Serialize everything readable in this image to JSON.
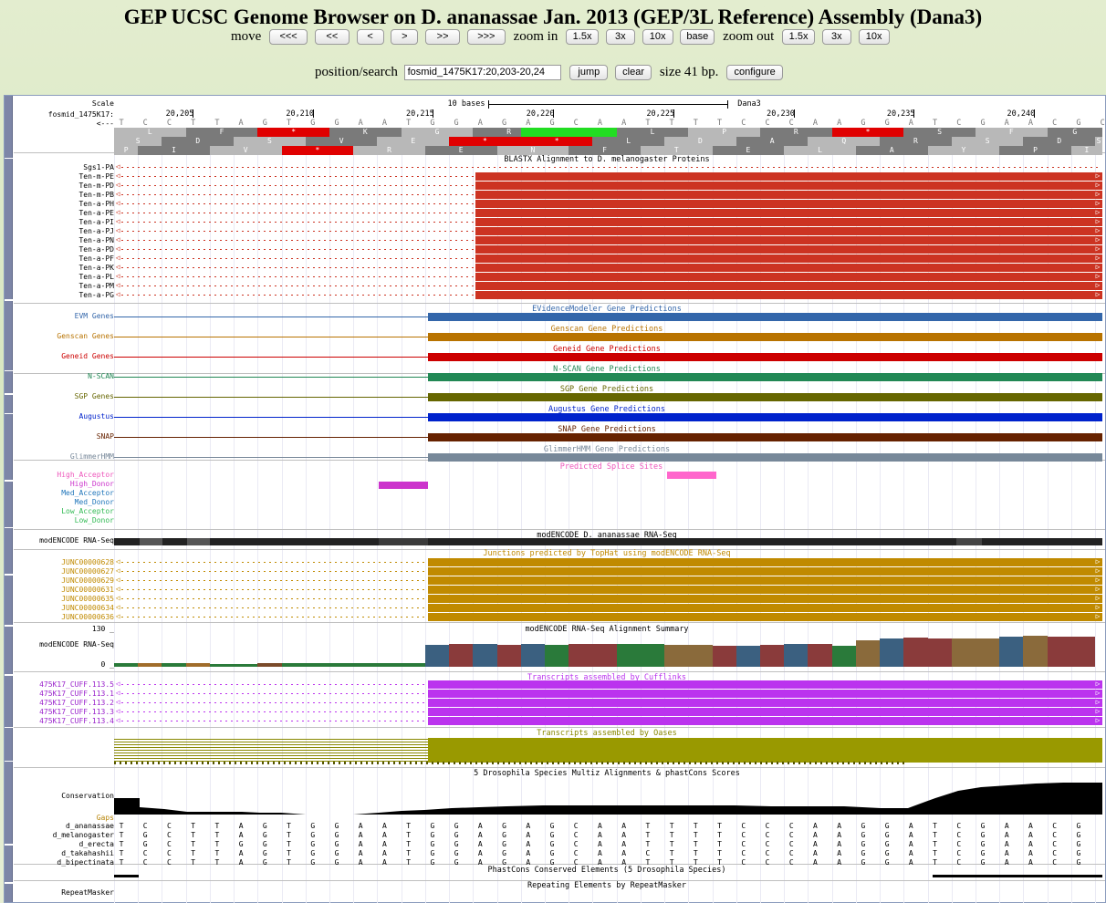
{
  "title": "GEP UCSC Genome Browser on D. ananassae Jan. 2013 (GEP/3L Reference) Assembly (Dana3)",
  "controls": {
    "move_label": "move",
    "move_buttons": [
      "<<<",
      "<<",
      "<",
      ">",
      ">>",
      ">>>"
    ],
    "zoom_in_label": "zoom in",
    "zoom_in_buttons": [
      "1.5x",
      "3x",
      "10x"
    ],
    "base_button": "base",
    "zoom_out_label": "zoom out",
    "zoom_out_buttons": [
      "1.5x",
      "3x",
      "10x"
    ],
    "position_label": "position/search",
    "position_value": "fosmid_1475K17:20,203-20,24",
    "jump": "jump",
    "clear": "clear",
    "size_text": "size 41 bp.",
    "configure": "configure"
  },
  "ruler": {
    "scale_label": "Scale",
    "chrom_label": "fosmid_1475K17:",
    "strand_label": "<---",
    "bases_label": "10 bases",
    "assembly": "Dana3",
    "ticks": [
      "20,205",
      "20,210",
      "20,215",
      "20,220",
      "20,225",
      "20,230",
      "20,235",
      "20,240"
    ],
    "sequence": "TCCTTAGTGGAATGGAGAGCAATTTTCCCAAGGATCGAACGCA",
    "frame1": [
      "L",
      "F",
      "*",
      "K",
      "G",
      "R",
      "M",
      "L",
      "P",
      "R",
      "*",
      "S",
      "F",
      "G"
    ],
    "frame2": [
      "S",
      "D",
      "S",
      "V",
      "E",
      "*",
      "*",
      "L",
      "D",
      "A",
      "Q",
      "R"
    ],
    "frame3": [
      "P",
      "I",
      "V",
      "*",
      "R",
      "E",
      "N",
      "F",
      "T",
      "E",
      "L",
      "A",
      "Y"
    ]
  },
  "tracks": {
    "blastx": {
      "title": "BLASTX Alignment to D. melanogaster Proteins",
      "labels": [
        "Sgs1-PA",
        "Ten-m-PE",
        "Ten-m-PD",
        "Ten-m-PB",
        "Ten-a-PH",
        "Ten-a-PE",
        "Ten-a-PI",
        "Ten-a-PJ",
        "Ten-a-PN",
        "Ten-a-PD",
        "Ten-a-PF",
        "Ten-a-PK",
        "Ten-a-PL",
        "Ten-a-PM",
        "Ten-a-PG"
      ],
      "color": "#cc3322"
    },
    "genes": [
      {
        "label": "EVM Genes",
        "title": "EVidenceModeler Gene Predictions",
        "color": "#3366aa"
      },
      {
        "label": "Genscan Genes",
        "title": "Genscan Gene Predictions",
        "color": "#b87300"
      },
      {
        "label": "Geneid Genes",
        "title": "Geneid Gene Predictions",
        "color": "#cc0000"
      },
      {
        "label": "N-SCAN",
        "title": "N-SCAN Gene Predictions",
        "color": "#228855"
      },
      {
        "label": "SGP Genes",
        "title": "SGP Gene Predictions",
        "color": "#666600"
      },
      {
        "label": "Augustus",
        "title": "Augustus Gene Predictions",
        "color": "#0022cc"
      },
      {
        "label": "SNAP",
        "title": "SNAP Gene Predictions",
        "color": "#662200"
      },
      {
        "label": "GlimmerHMM",
        "title": "GlimmerHMM Gene Predictions",
        "color": "#778899"
      }
    ],
    "splice": {
      "title": "Predicted Splice Sites",
      "labels": [
        {
          "t": "High_Acceptor",
          "c": "#ee55bb"
        },
        {
          "t": "High_Donor",
          "c": "#cc33cc"
        },
        {
          "t": "Med_Acceptor",
          "c": "#2277bb"
        },
        {
          "t": "Med_Donor",
          "c": "#2277bb"
        },
        {
          "t": "Low_Acceptor",
          "c": "#33bb55"
        },
        {
          "t": "Low_Donor",
          "c": "#33bb55"
        }
      ]
    },
    "rnaseq": {
      "label": "modENCODE RNA-Seq",
      "title": "modENCODE D. ananassae RNA-Seq"
    },
    "junctions": {
      "title": "Junctions predicted by TopHat using modENCODE RNA-Seq",
      "labels": [
        "JUNC00000628",
        "JUNC00000627",
        "JUNC00000629",
        "JUNC00000631",
        "JUNC00000635",
        "JUNC00000634",
        "JUNC00000636"
      ],
      "color": "#c08a00"
    },
    "summary": {
      "title": "modENCODE RNA-Seq Alignment Summary",
      "label": "modENCODE RNA-Seq",
      "max": "130 _",
      "min": "0 _"
    },
    "cufflinks": {
      "title": "Transcripts assembled by Cufflinks",
      "labels": [
        "475K17_CUFF.113.5",
        "475K17_CUFF.113.1",
        "475K17_CUFF.113.2",
        "475K17_CUFF.113.3",
        "475K17_CUFF.113.4"
      ],
      "color": "#bb33ee"
    },
    "oases": {
      "title": "Transcripts assembled by Oases",
      "color": "#888800"
    },
    "multiz": {
      "title": "5 Drosophila Species Multiz Alignments & phastCons Scores",
      "cons_label": "Conservation",
      "gaps_label": "Gaps",
      "species": [
        "d_ananassae",
        "d_melanogaster",
        "d_erecta",
        "d_takahashii",
        "d_bipectinata"
      ]
    },
    "phastcons": {
      "title": "PhastCons Conserved Elements (5 Drosophila Species)"
    },
    "repeat": {
      "title": "Repeating Elements by RepeatMasker",
      "label": "RepeatMasker"
    }
  }
}
